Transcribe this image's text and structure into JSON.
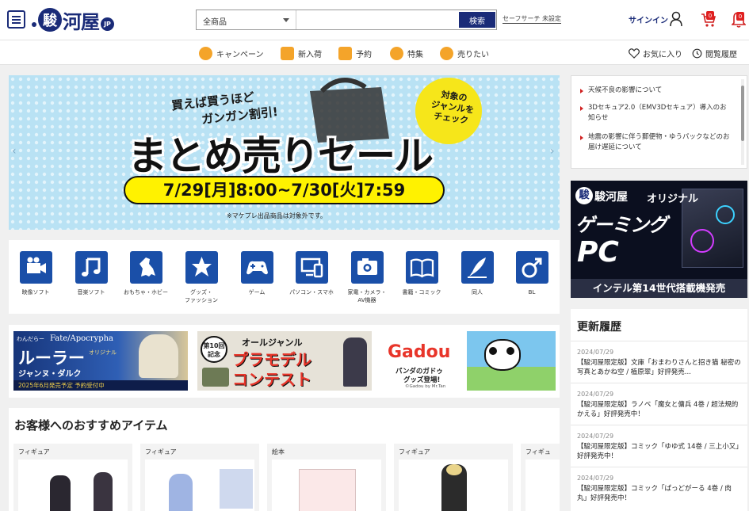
{
  "header": {
    "logo_seal": "駿",
    "logo_text": "河屋",
    "logo_jp": "JP",
    "search_category": "全商品",
    "search_placeholder": "",
    "search_button": "検索",
    "safe_search": "セーフサーチ 未設定",
    "signin": "サインイン",
    "cart_count": "0",
    "notify_count": "0"
  },
  "nav": {
    "items": [
      "キャンペーン",
      "新入荷",
      "予約",
      "特集",
      "売りたい"
    ],
    "favorites": "お気に入り",
    "history": "閲覧履歴"
  },
  "banner": {
    "top_line1": "買えば買うほど",
    "top_line2": "ガンガン割引!",
    "title": "まとめ売りセール",
    "badge_line1": "対象の",
    "badge_line2": "ジャンルを",
    "badge_line3": "チェック",
    "date": "7/29[月]8:00~7/30[火]7:59",
    "note": "※マケプレ出品商品は対象外です。",
    "prev": "‹",
    "next": "›"
  },
  "categories": [
    {
      "label": "映像ソフト",
      "icon": "projector-icon"
    },
    {
      "label": "音楽ソフト",
      "icon": "music-note-icon"
    },
    {
      "label": "おもちゃ・ホビー",
      "icon": "kaiju-icon"
    },
    {
      "label": "グッズ・\nファッション",
      "icon": "star-badge-icon"
    },
    {
      "label": "ゲーム",
      "icon": "gamepad-icon"
    },
    {
      "label": "パソコン・スマホ",
      "icon": "devices-icon"
    },
    {
      "label": "家電・カメラ・\nAV機器",
      "icon": "camera-icon"
    },
    {
      "label": "書籍・コミック",
      "icon": "book-icon"
    },
    {
      "label": "同人",
      "icon": "pen-icon"
    },
    {
      "label": "BL",
      "icon": "male-icon"
    }
  ],
  "promos": {
    "fate": {
      "brand": "わんだらー",
      "series": "Fate/Apocrypha",
      "name": "ルーラー",
      "sub": "ジャンヌ・ダルク",
      "tag": "オリジナル",
      "footer": "2025年6月発売予定 予約受付中"
    },
    "contest": {
      "badge": "第10回記念",
      "line1": "オールジャンル",
      "line2": "プラモデル",
      "line3": "コンテスト"
    },
    "gadou": {
      "brand": "Gadou",
      "line1": "パンダのガドゥ",
      "line2": "グッズ登場!",
      "credit": "©Gadou by Mr.Tan"
    }
  },
  "recommend": {
    "title": "お客様へのおすすめアイテム",
    "cards": [
      {
        "label": "フィギュア"
      },
      {
        "label": "フィギュア"
      },
      {
        "label": "絵本"
      },
      {
        "label": "フィギュア"
      },
      {
        "label": "フィギュ"
      }
    ]
  },
  "news": [
    "天候不良の影響について",
    "3Dセキュア2.0（EMV3Dセキュア）導入のお知らせ",
    "地震の影響に伴う郵便物・ゆうパックなどのお届け遅延について"
  ],
  "gaming": {
    "logo": "駿河屋",
    "original": "オリジナル",
    "line1": "ゲーミング",
    "line2": "PC",
    "footer": "インテル第14世代搭載機発売"
  },
  "history": {
    "title": "更新履歴",
    "items": [
      {
        "date": "2024/07/29",
        "text": "【駿河屋限定版】文庫「おまわりさんと招き猫 秘密の写真とあかね空 / 植原翠」好評発売..."
      },
      {
        "date": "2024/07/29",
        "text": "【駿河屋限定版】ラノベ「魔女と傭兵 4巻 / 超法規的かえる」好評発売中！"
      },
      {
        "date": "2024/07/29",
        "text": "【駿河屋限定版】コミック「ゆゆ式 14巻 / 三上小又」好評発売中！"
      },
      {
        "date": "2024/07/29",
        "text": "【駿河屋限定版】コミック「ぱっどがーる 4巻 / 肉丸」好評発売中！"
      }
    ]
  },
  "colors": {
    "brand": "#1a2b78",
    "accent": "#f4a42a",
    "category": "#1a4fa8",
    "alert": "#e02020"
  }
}
